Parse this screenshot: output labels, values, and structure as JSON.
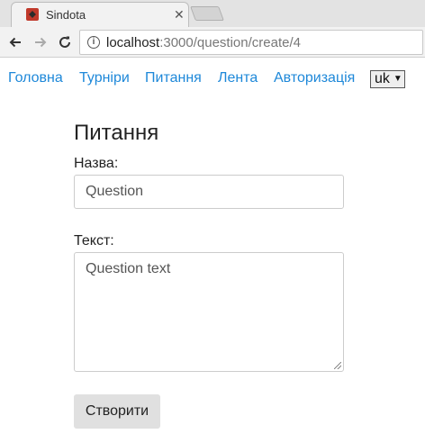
{
  "browser": {
    "tab_title": "Sindota",
    "url_host": "localhost",
    "url_rest": ":3000/question/create/4"
  },
  "nav": {
    "links": [
      "Головна",
      "Турніри",
      "Питання",
      "Лента",
      "Авторизація"
    ],
    "language": "uk"
  },
  "form": {
    "title": "Питання",
    "name_label": "Назва:",
    "name_placeholder": "Question",
    "text_label": "Текст:",
    "text_placeholder": "Question text",
    "submit_label": "Створити"
  }
}
